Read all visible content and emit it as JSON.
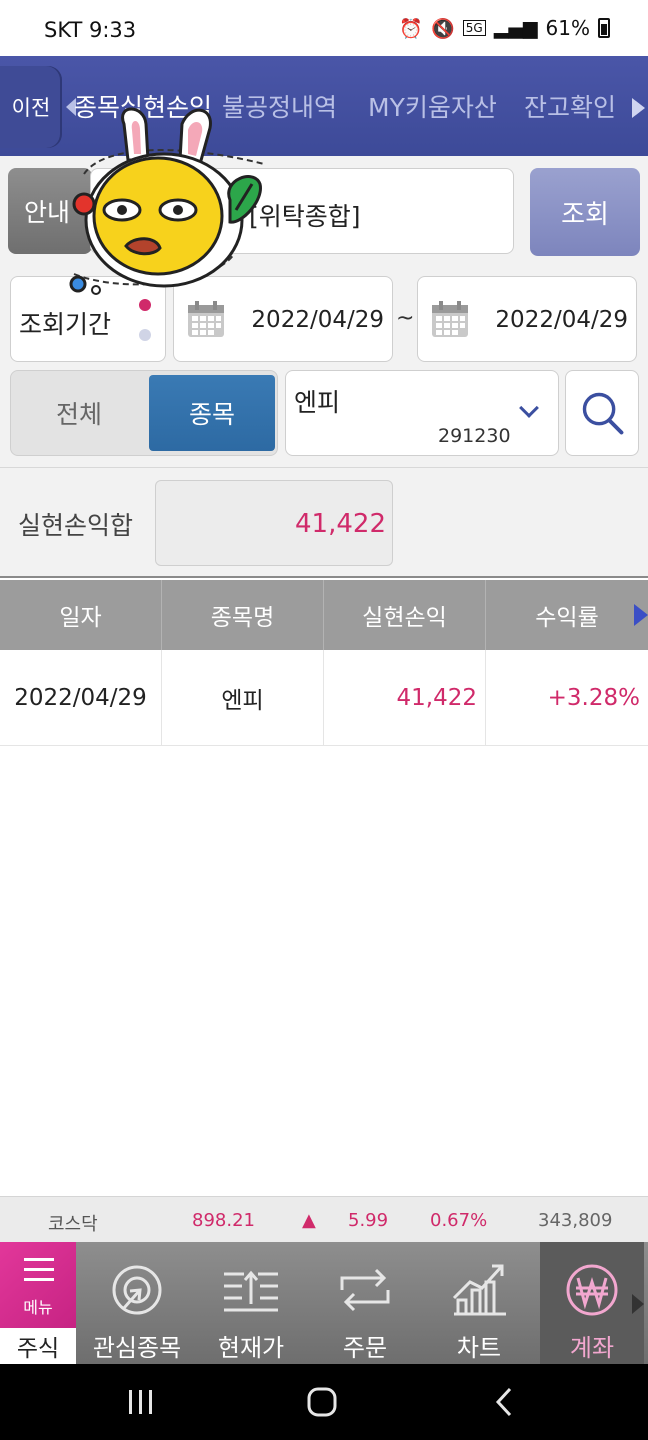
{
  "status_bar": {
    "carrier_time": "SKT 9:33",
    "network": "5G",
    "battery": "61%"
  },
  "top_nav": {
    "back_label": "이전",
    "tabs": [
      {
        "label": "종목실현손익",
        "active": true
      },
      {
        "label": "불공정내역",
        "active": false
      },
      {
        "label": "MY키움자산",
        "active": false
      },
      {
        "label": "잔고확인",
        "active": false
      }
    ]
  },
  "form": {
    "guide_label": "안내",
    "account_type": "[위탁종합]",
    "query_label": "조회",
    "period_label": "조회기간",
    "date_from": "2022/04/29",
    "date_to": "2022/04/29",
    "range_sep": "~",
    "filter_all": "전체",
    "filter_stock": "종목",
    "stock_name": "엔피",
    "stock_code": "291230"
  },
  "summary": {
    "label": "실현손익합",
    "value": "41,422"
  },
  "table": {
    "columns": [
      "일자",
      "종목명",
      "실현손익",
      "수익률"
    ],
    "rows": [
      {
        "date": "2022/04/29",
        "name": "엔피",
        "pnl": "41,422",
        "rate": "+3.28%"
      }
    ]
  },
  "ticker": {
    "index_name": "코스닥",
    "value": "898.21",
    "direction": "▲",
    "change": "5.99",
    "change_pct": "0.67%",
    "volume": "343,809"
  },
  "bottom_nav": {
    "menu_label": "메뉴",
    "stock_label": "주식",
    "items": [
      {
        "label": "관심종목",
        "icon": "watchlist-icon",
        "active": false
      },
      {
        "label": "현재가",
        "icon": "current-price-icon",
        "active": false
      },
      {
        "label": "주문",
        "icon": "order-icon",
        "active": false
      },
      {
        "label": "차트",
        "icon": "chart-icon",
        "active": false
      },
      {
        "label": "계좌",
        "icon": "won-icon",
        "active": true
      }
    ]
  },
  "colors": {
    "header_blue": "#4a56a8",
    "positive_red": "#d02a6a",
    "active_tab_blue": "#2d6aa3",
    "menu_pink": "#e2379a"
  }
}
